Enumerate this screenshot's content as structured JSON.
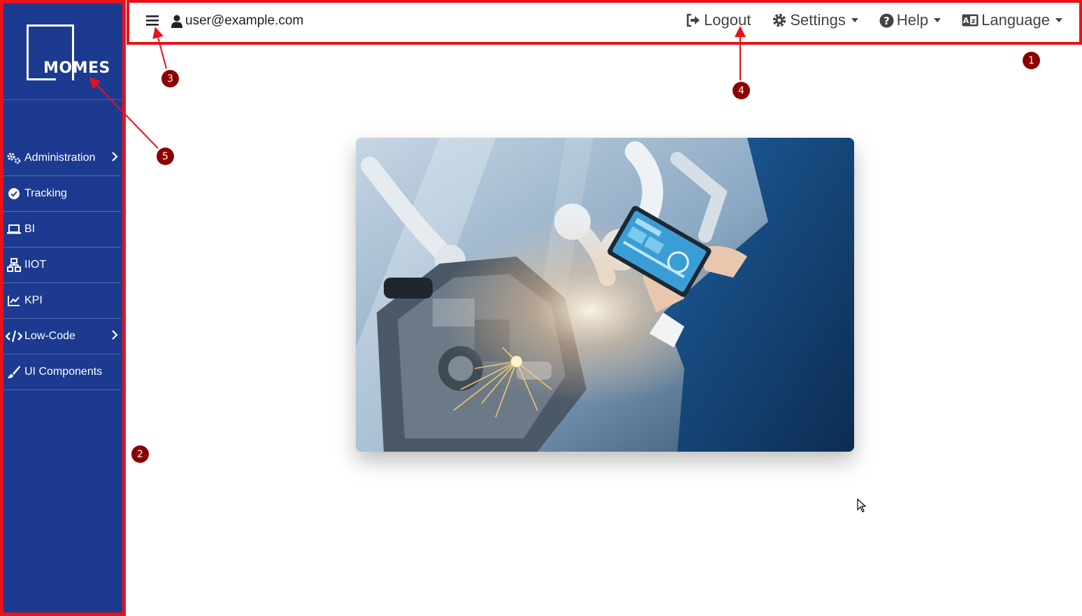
{
  "sidebar": {
    "logo_text": "MOMES",
    "items": [
      {
        "label": "Administration",
        "icon": "gears-icon",
        "has_submenu": true
      },
      {
        "label": "Tracking",
        "icon": "check-circle-icon",
        "has_submenu": false
      },
      {
        "label": "BI",
        "icon": "laptop-icon",
        "has_submenu": false
      },
      {
        "label": "IIOT",
        "icon": "network-icon",
        "has_submenu": false
      },
      {
        "label": "KPI",
        "icon": "line-chart-icon",
        "has_submenu": false
      },
      {
        "label": "Low-Code",
        "icon": "code-icon",
        "has_submenu": true
      },
      {
        "label": "UI Components",
        "icon": "brush-icon",
        "has_submenu": false
      }
    ]
  },
  "topbar": {
    "user": "user@example.com",
    "logout_label": "Logout",
    "settings_label": "Settings",
    "help_label": "Help",
    "language_label": "Language"
  },
  "annotations": [
    "1",
    "2",
    "3",
    "4",
    "5"
  ],
  "colors": {
    "sidebar_bg": "#1c3a8f",
    "highlight_border": "#e8121b",
    "badge_bg": "#8b0000",
    "arrow": "#e8121b"
  }
}
